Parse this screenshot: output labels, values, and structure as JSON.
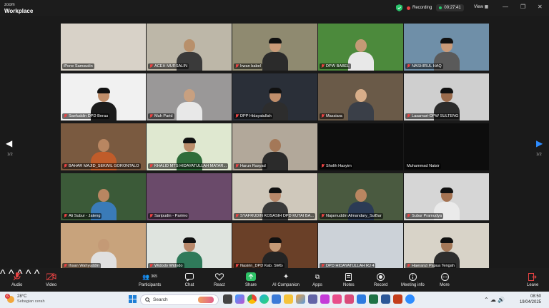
{
  "app": {
    "brand_small": "zoom",
    "brand": "Workplace"
  },
  "topbar": {
    "recording": "Recording",
    "timer": "00:27:41",
    "view": "View"
  },
  "pager": {
    "left": "1/2",
    "right": "1/2"
  },
  "colors": {
    "active_border": "#2ed36f",
    "recording_red": "#e94343",
    "share_green": "#2ec266"
  },
  "tiles": [
    {
      "name": "iPone Samsudin",
      "muted": false,
      "bg": "#d8d2c8",
      "skin": "",
      "body": "",
      "cap": false
    },
    {
      "name": "ACEH MURSALIN",
      "muted": true,
      "bg": "#bdb7a8",
      "skin": "#b8906b",
      "body": "#3a3a3a",
      "cap": false
    },
    {
      "name": "Irwan babel",
      "muted": true,
      "bg": "#8f8a70",
      "skin": "#c99a78",
      "body": "#2b2b2b",
      "cap": true
    },
    {
      "name": "DPW BABEL",
      "muted": true,
      "bg": "#4c8a3c",
      "skin": "#c49a76",
      "body": "#e8e8e8",
      "cap": false
    },
    {
      "name": "NASHIRUL HAQ",
      "muted": true,
      "bg": "#6f8fa8",
      "skin": "#c99a78",
      "body": "#5a5a5a",
      "cap": true,
      "active": true
    },
    {
      "name": "Saefuddin DPD Berau",
      "muted": true,
      "bg": "#f1f1f1",
      "skin": "#c08e6a",
      "body": "#1c1c1c",
      "cap": true
    },
    {
      "name": "Muh Parid",
      "muted": true,
      "bg": "#9a9898",
      "skin": "#c8a080",
      "body": "#e8e8e8",
      "cap": false
    },
    {
      "name": "DPP Hidayatullah",
      "muted": true,
      "bg": "#2a2f38",
      "skin": "#c08e6a",
      "body": "#2d2d2d",
      "cap": true
    },
    {
      "name": "Massiara",
      "muted": true,
      "bg": "#6a5a48",
      "skin": "#d8ae8a",
      "body": "#3a3f48",
      "cap": false
    },
    {
      "name": "Lasamuri-DPW SULTENG",
      "muted": true,
      "bg": "#cfcfcf",
      "skin": "#9a6b4c",
      "body": "#2b2b2b",
      "cap": true
    },
    {
      "name": "BAHAR MAJID_SEKWIL GORONTALO",
      "muted": true,
      "bg": "#7a5a40",
      "skin": "#b98661",
      "body": "#c05c2a",
      "cap": false
    },
    {
      "name": "KHALID MTS HIDAYATULLAH MATAR...",
      "muted": true,
      "bg": "#dfe8d0",
      "skin": "#bb8d6a",
      "body": "#2f6d3a",
      "cap": true
    },
    {
      "name": "Harun Rasyad",
      "muted": true,
      "bg": "#b2a89a",
      "skin": "#a47858",
      "body": "#2b2b2b",
      "cap": false
    },
    {
      "name": "Sholih Hasyim",
      "muted": true,
      "bg": "#0d0d0d",
      "skin": "",
      "body": "",
      "cap": false
    },
    {
      "name": "Muhammad Natsir",
      "muted": false,
      "bg": "#0d0d0d",
      "skin": "",
      "body": "",
      "cap": false
    },
    {
      "name": "Ali Subur - Jateng",
      "muted": true,
      "bg": "#3b5a38",
      "skin": "#b98661",
      "body": "#3a7bb8",
      "cap": false
    },
    {
      "name": "Saripudin - Parimo",
      "muted": true,
      "bg": "#6a4a6a",
      "skin": "",
      "body": "",
      "cap": false
    },
    {
      "name": "SYAFRUDIN KOSASIH DPD KUTAI BA...",
      "muted": true,
      "bg": "#cfc8bb",
      "skin": "#b8886a",
      "body": "#3a3a3a",
      "cap": true
    },
    {
      "name": "Najamuddin Almandary_SulBar",
      "muted": true,
      "bg": "#4a5a40",
      "skin": "#b98661",
      "body": "#2b3b55",
      "cap": false
    },
    {
      "name": "Subur Pramudya",
      "muted": true,
      "bg": "#d6d6d6",
      "skin": "#a57352",
      "body": "#eaeaea",
      "cap": true
    },
    {
      "name": "Ihsan Wahyuddin",
      "muted": true,
      "bg": "#c8a37c",
      "skin": "#c49a76",
      "body": "#e0e0e0",
      "cap": false
    },
    {
      "name": "Widodo Widodo",
      "muted": true,
      "bg": "#dfe4df",
      "skin": "#b8886a",
      "body": "#2f7a5a",
      "cap": true
    },
    {
      "name": "Nasirin_DPD Kab. SMG",
      "muted": true,
      "bg": "#6a4028",
      "skin": "#c49a76",
      "body": "#242424",
      "cap": true
    },
    {
      "name": "DPD HIDAYATULLAH RJ 4",
      "muted": true,
      "bg": "#ccd2d8",
      "skin": "",
      "body": "",
      "cap": false
    },
    {
      "name": "Haeranzi Papua Tengah",
      "muted": true,
      "bg": "#d8d3c8",
      "skin": "#a47858",
      "body": "#2d2d2d",
      "cap": true
    }
  ],
  "toolbar": {
    "audio": "Audio",
    "video": "Video",
    "participants": "Participants",
    "participants_count": "365",
    "chat": "Chat",
    "react": "React",
    "share": "Share",
    "ai": "AI Companion",
    "apps": "Apps",
    "notes": "Notes",
    "record": "Record",
    "meeting_info": "Meeting info",
    "more": "More",
    "leave": "Leave"
  },
  "taskbar": {
    "temp": "28°C",
    "weather": "Sebagian cerah",
    "badge": "6",
    "search_placeholder": "Search",
    "time": "08:50",
    "date": "19/04/2025"
  }
}
